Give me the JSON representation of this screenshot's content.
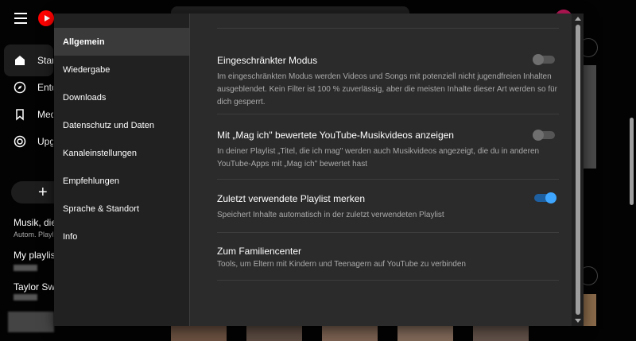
{
  "sidebar": {
    "items": [
      {
        "label": "Start",
        "icon": "home-icon"
      },
      {
        "label": "Entdecken",
        "icon": "compass-icon"
      },
      {
        "label": "Mediathek",
        "icon": "bookmark-icon"
      },
      {
        "label": "Upgrade",
        "icon": "upgrade-icon"
      }
    ],
    "new_playlist_symbol": "+",
    "playlists": [
      {
        "title": "Musik, die ich mag",
        "sub": "Autom. Playlist"
      },
      {
        "title": "My playlist"
      },
      {
        "title": "Taylor Swift"
      }
    ]
  },
  "dialog": {
    "nav": [
      "Allgemein",
      "Wiedergabe",
      "Downloads",
      "Datenschutz und Daten",
      "Kanaleinstellungen",
      "Empfehlungen",
      "Sprache & Standort",
      "Info"
    ],
    "active_nav": "Allgemein",
    "settings": [
      {
        "title": "Eingeschränkter Modus",
        "desc": "Im eingeschränkten Modus werden Videos und Songs mit potenziell nicht jugendfreien Inhalten ausgeblendet. Kein Filter ist 100 % zuverlässig, aber die meisten Inhalte dieser Art werden so für dich gesperrt.",
        "enabled": false
      },
      {
        "title": "Mit „Mag ich\" bewertete YouTube-Musikvideos anzeigen",
        "desc": "In deiner Playlist „Titel, die ich mag\" werden auch Musikvideos angezeigt, die du in anderen YouTube-Apps mit „Mag ich\" bewertet hast",
        "enabled": false
      },
      {
        "title": "Zuletzt verwendete Playlist merken",
        "desc": "Speichert Inhalte automatisch in der zuletzt verwendeten Playlist",
        "enabled": true
      },
      {
        "title": "Zum Familiencenter",
        "desc": "Tools, um Eltern mit Kindern und Teenagern auf YouTube zu verbinden"
      }
    ]
  },
  "colors": {
    "accent": "#3ea6ff",
    "logo": "#ff0000"
  }
}
